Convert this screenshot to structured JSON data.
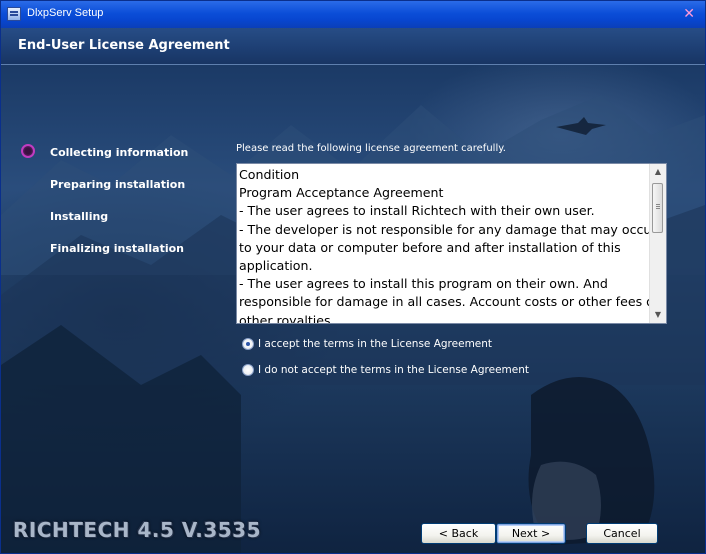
{
  "window": {
    "title": "DlxpServ Setup"
  },
  "header": {
    "title": "End-User License Agreement"
  },
  "steps": [
    {
      "label": "Collecting information",
      "active": true
    },
    {
      "label": "Preparing installation",
      "active": false
    },
    {
      "label": "Installing",
      "active": false
    },
    {
      "label": "Finalizing installation",
      "active": false
    }
  ],
  "license": {
    "instruction": "Please read the following license agreement carefully.",
    "lines": [
      "Condition",
      "Program Acceptance Agreement",
      "- The user agrees to install Richtech with their own user.",
      "- The developer is not responsible for any damage that may occur",
      "to your data or computer before and after installation of this",
      "application.",
      "- The user agrees to install this program on their own. And",
      "responsible for damage in all cases. Account costs or other fees or",
      "other royalties."
    ]
  },
  "options": {
    "accept": {
      "label": "I accept the terms in the License Agreement",
      "checked": true
    },
    "decline": {
      "label": "I do not accept the terms in the License Agreement",
      "checked": false
    }
  },
  "brand": {
    "text": "RICHTECH 4.5 V.3535"
  },
  "buttons": {
    "back": "< Back",
    "next": "Next >",
    "cancel": "Cancel"
  },
  "colors": {
    "title_bar": "#0b4ed8",
    "header": "#1d3e72",
    "step_indicator": "#c03cc0",
    "background": "#1b3a66"
  }
}
